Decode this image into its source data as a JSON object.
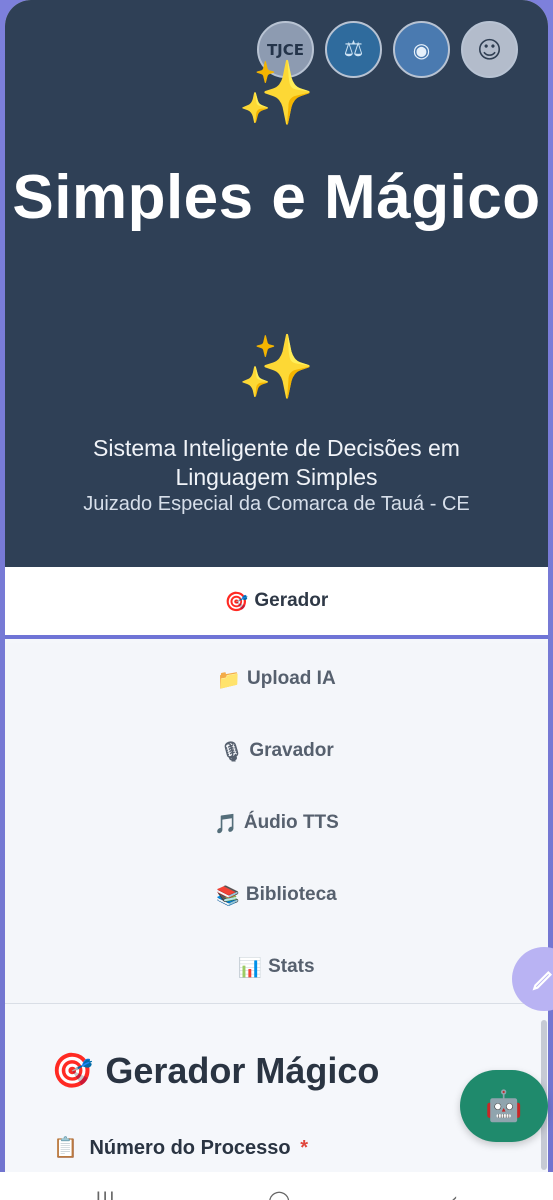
{
  "hero": {
    "badges": [
      {
        "label": "TJCE"
      },
      {
        "label": "⚖"
      },
      {
        "label": "◉"
      },
      {
        "label": "☺"
      }
    ],
    "sparkle_top": "✨",
    "title": "Simples e Mágico",
    "sparkle_bottom": "✨",
    "subtitle": "Sistema Inteligente de Decisões em Linguagem Simples",
    "court": "Juizado Especial da Comarca de Tauá - CE"
  },
  "tabs": {
    "active": {
      "icon": "🎯",
      "label": "Gerador"
    },
    "items": [
      {
        "icon": "📁",
        "label": "Upload IA"
      },
      {
        "icon": "🎙",
        "label": "Gravador"
      },
      {
        "icon": "🎵",
        "label": "Áudio TTS"
      },
      {
        "icon": "📚",
        "label": "Biblioteca"
      },
      {
        "icon": "📊",
        "label": "Stats"
      }
    ]
  },
  "main": {
    "section_icon": "🎯",
    "section_title": "Gerador Mágico",
    "field_icon": "📋",
    "field_label": "Número do Processo",
    "required_mark": "*"
  },
  "fabs": {
    "side_icon": "pen-icon",
    "bot_icon": "🤖"
  },
  "navbar": {
    "recent": "|||",
    "home": "◯",
    "back": "‹"
  },
  "colors": {
    "hero_bg": "#2f4056",
    "accent": "#6f74d6",
    "bot_fab": "#1f8a6c",
    "required": "#e0463c"
  }
}
